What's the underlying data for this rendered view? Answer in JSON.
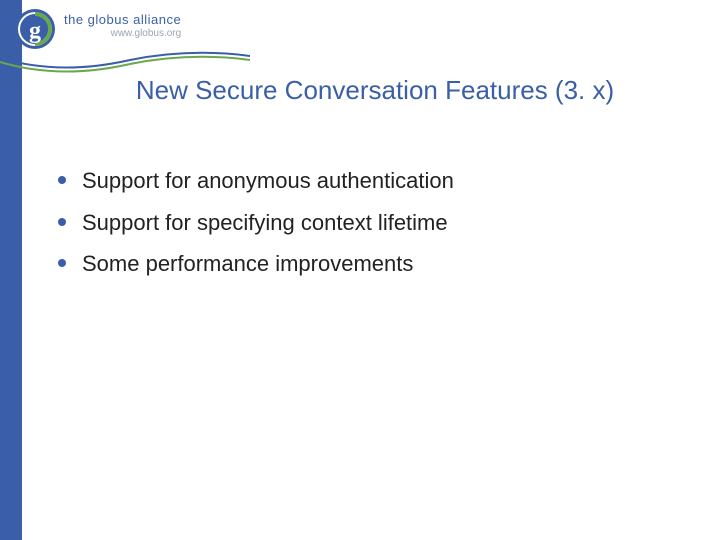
{
  "logo": {
    "alliance_text": "the globus alliance",
    "url_text": "www.globus.org"
  },
  "title": "New Secure Conversation Features (3. x)",
  "bullets": [
    "Support for anonymous authentication",
    "Support for specifying context lifetime",
    "Some performance improvements"
  ],
  "colors": {
    "brand_blue": "#3a5fa8",
    "brand_green": "#6aa84f"
  }
}
